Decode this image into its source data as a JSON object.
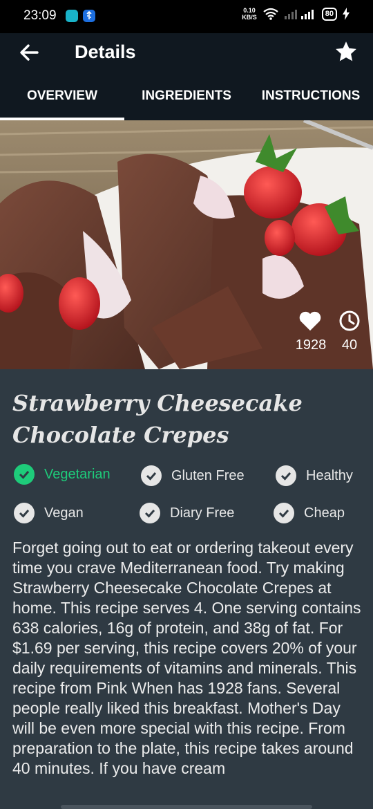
{
  "status_bar": {
    "time": "23:09",
    "speed_value": "0.10",
    "speed_unit": "KB/S",
    "battery": "80",
    "icons": [
      "messenger-icon",
      "usb-icon",
      "wifi-icon",
      "signal-icon",
      "battery-icon",
      "charging-icon"
    ]
  },
  "header": {
    "title": "Details",
    "back_icon": "arrow-left-icon",
    "favorite_icon": "star-icon"
  },
  "tabs": [
    {
      "label": "OVERVIEW",
      "active": true
    },
    {
      "label": "INGREDIENTS",
      "active": false
    },
    {
      "label": "INSTRUCTIONS",
      "active": false
    }
  ],
  "hero": {
    "likes": "1928",
    "minutes": "40"
  },
  "recipe": {
    "title": "Strawberry Cheesecake Chocolate Crepes",
    "tags": [
      {
        "label": "Vegetarian",
        "active": true
      },
      {
        "label": "Gluten Free",
        "active": false
      },
      {
        "label": "Healthy",
        "active": false
      },
      {
        "label": "Vegan",
        "active": false
      },
      {
        "label": "Diary Free",
        "active": false
      },
      {
        "label": "Cheap",
        "active": false
      }
    ],
    "summary": "Forget going out to eat or ordering takeout every time you crave Mediterranean food. Try making Strawberry Cheesecake Chocolate Crepes at home. This recipe serves 4. One serving contains 638 calories, 16g of protein, and 38g of fat. For $1.69 per serving, this recipe covers 20% of your daily requirements of vitamins and minerals. This recipe from Pink When has 1928 fans. Several people really liked this breakfast. Mother's Day will be even more special with this recipe. From preparation to the plate, this recipe takes around 40 minutes. If you have cream"
  },
  "colors": {
    "app_bar": "#101820",
    "background": "#2f3a43",
    "active_tag": "#1ecb7a"
  }
}
